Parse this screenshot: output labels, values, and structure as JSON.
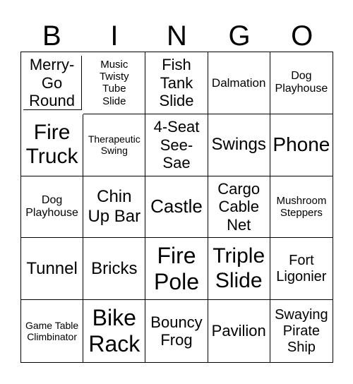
{
  "header": [
    "B",
    "I",
    "N",
    "G",
    "O"
  ],
  "cells": [
    "Merry-Go Round",
    "Music Twisty Tube Slide",
    "Fish Tank Slide",
    "Dalmation",
    "Dog Playhouse",
    "Fire Truck",
    "Therapeutic Swing",
    "4-Seat See-Sae",
    "Swings",
    "Phone",
    "Dog Playhouse",
    "Chin Up Bar",
    "Castle",
    "Cargo Cable Net",
    "Mushroom Steppers",
    "Tunnel",
    "Bricks",
    "Fire Pole",
    "Triple Slide",
    "Fort Ligonier",
    "Game Table Climbinator",
    "Bike Rack",
    "Bouncy Frog",
    "Pavilion",
    "Swaying Pirate Ship"
  ]
}
